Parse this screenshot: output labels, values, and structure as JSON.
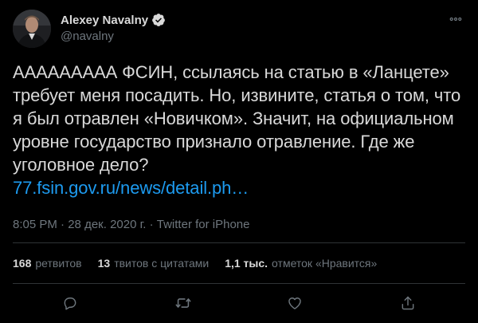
{
  "author": {
    "display_name": "Alexey Navalny",
    "handle": "@navalny",
    "verified": true
  },
  "tweet": {
    "text": "ААААААААА ФСИН, ссылаясь на статью в «Ланцете» требует меня посадить. Но, извините, статья о том, что я был отравлен «Новичком». Значит, на официальном уровне государство признало отравление. Где же уголовное дело?",
    "link_text": "77.fsin.gov.ru/news/detail.ph…",
    "time": "8:05 PM",
    "date": "28 дек. 2020 г.",
    "source": "Twitter for iPhone",
    "separator": "·"
  },
  "stats": {
    "retweets_count": "168",
    "retweets_label": "ретвитов",
    "quotes_count": "13",
    "quotes_label": "твитов с цитатами",
    "likes_count": "1,1 тыс.",
    "likes_label": "отметок «Нравится»"
  },
  "colors": {
    "background": "#000000",
    "text": "#d9d9d9",
    "secondary": "#6e767d",
    "link": "#1d9bf0",
    "divider": "#2f3336"
  },
  "icons": [
    "verified-badge-icon",
    "more-options-icon",
    "reply-icon",
    "retweet-icon",
    "like-icon",
    "share-icon"
  ]
}
